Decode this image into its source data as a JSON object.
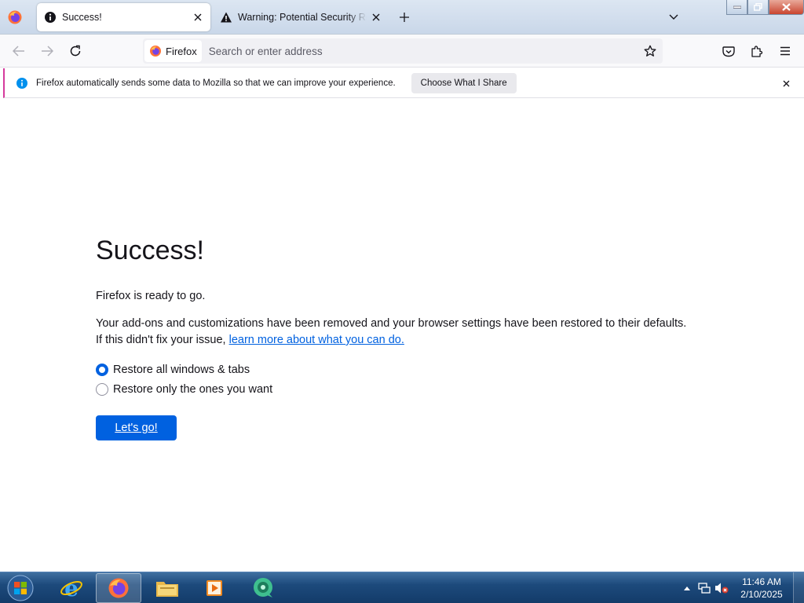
{
  "window": {
    "minimize_label": "Minimize",
    "maximize_label": "Restore Down",
    "close_label": "Close"
  },
  "tabs": [
    {
      "title": "Success!",
      "icon": "info-icon",
      "active": true
    },
    {
      "title": "Warning: Potential Security Risk Ahead",
      "icon": "warning-icon",
      "active": false
    }
  ],
  "navbar": {
    "identity_label": "Firefox",
    "url_placeholder": "Search or enter address"
  },
  "notification": {
    "message": "Firefox automatically sends some data to Mozilla so that we can improve your experience.",
    "button_label": "Choose What I Share"
  },
  "page": {
    "title": "Success!",
    "ready_text": "Firefox is ready to go.",
    "reset_text": "Your add-ons and customizations have been removed and your browser settings have been restored to their defaults.",
    "help_prefix": "If this didn't fix your issue, ",
    "help_link": "learn more about what you can do.",
    "options": [
      {
        "label": "Restore all windows & tabs",
        "checked": true
      },
      {
        "label": "Restore only the ones you want",
        "checked": false
      }
    ],
    "go_button": "Let's go!"
  },
  "taskbar": {
    "pinned": [
      "internet-explorer-icon",
      "firefox-icon",
      "file-explorer-icon",
      "media-player-icon",
      "chat-app-icon"
    ],
    "clock_time": "11:46 AM",
    "clock_date": "2/10/2025"
  },
  "colors": {
    "accent": "#0061e0",
    "notification_border": "#d53a9d",
    "taskbar": "#1d4a7c"
  }
}
